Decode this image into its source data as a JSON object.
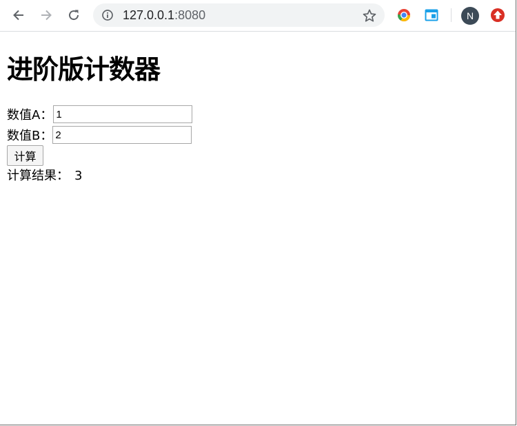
{
  "browser": {
    "url_host": "127.0.0.1",
    "url_port": ":8080",
    "profile_initial": "N"
  },
  "page": {
    "title": "进阶版计数器",
    "label_a": "数值A：",
    "value_a": "1",
    "label_b": "数值B：",
    "value_b": "2",
    "calc_button": "计算",
    "result_label": "计算结果：",
    "result_value": "3"
  }
}
